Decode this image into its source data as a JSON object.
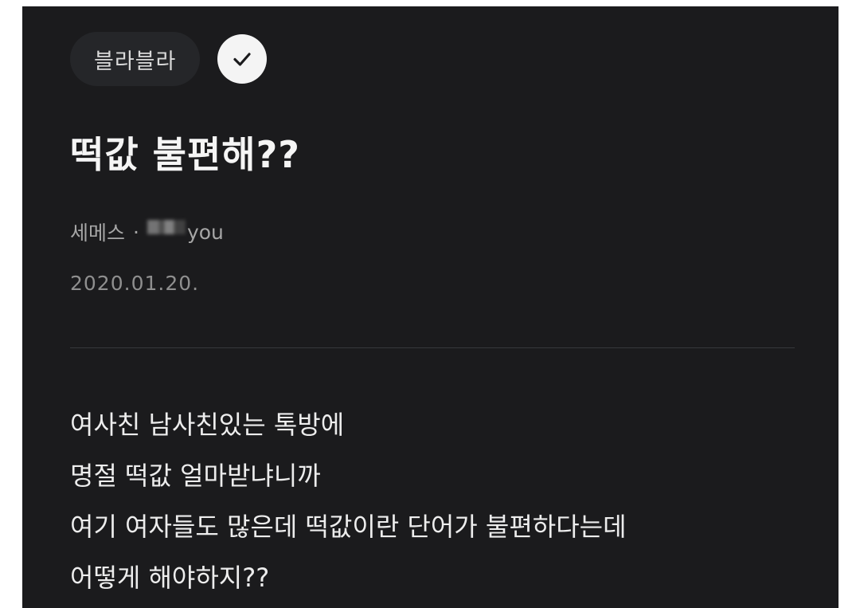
{
  "post": {
    "tag": "블라블라",
    "verified_icon": "check-circle-icon",
    "title": "떡값 불편해??",
    "company": "세메스",
    "separator": "·",
    "author": "you",
    "date": "2020.01.20.",
    "body_lines": [
      "여사친 남사친있는 톡방에",
      "명절 떡값 얼마받냐니까",
      "여기 여자들도 많은데 떡값이란 단어가 불편하다는데",
      "어떻게 해야하지??"
    ]
  },
  "colors": {
    "background": "#1b1b1d",
    "chip": "#252629",
    "text": "#ededed",
    "muted": "#a6a6a6"
  }
}
